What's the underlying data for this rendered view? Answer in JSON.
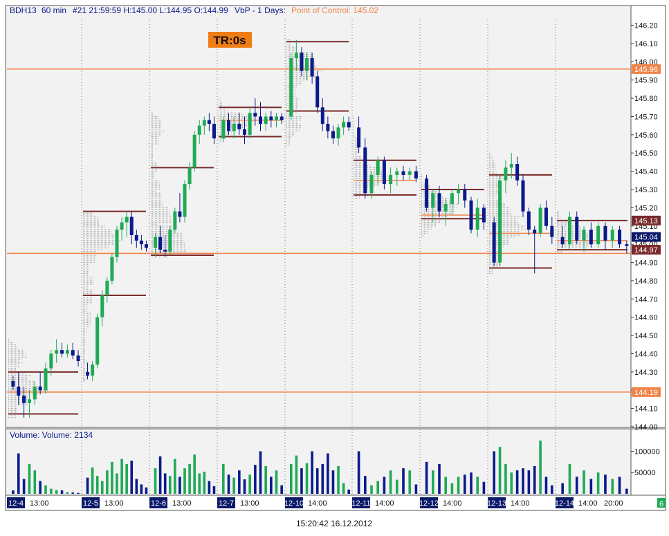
{
  "header": {
    "symbol": "BDH13",
    "interval": "60 min",
    "bar_info": "#21 21:59:59 H:145.00 L:144.95 O:144.99",
    "indicator": "VbP - 1 Days:",
    "poc_label": "Point of Control: 145.02"
  },
  "timer_badge": "TR:0s",
  "volume_panel": {
    "title": "Volume:  Volume: 2134"
  },
  "footer_timestamp": "15:20:42 16.12.2012",
  "status_badge": "6",
  "colors": {
    "up": "#1faa55",
    "down": "#0a1a8c",
    "profile": "#a9a9a9",
    "poc": "#f2844a",
    "value_area": "#7a2a2a",
    "badge": "#f07c14",
    "date_badge": "#0c1a6a"
  },
  "chart_data": [
    {
      "type": "candlestick",
      "title": "BDH13 60 min",
      "ylim": [
        144.0,
        146.24
      ],
      "y_ticks": [
        "146.20",
        "146.10",
        "146.00",
        "145.90",
        "145.80",
        "145.70",
        "145.60",
        "145.50",
        "145.40",
        "145.30",
        "145.20",
        "145.10",
        "145.00",
        "144.90",
        "144.80",
        "144.70",
        "144.60",
        "144.50",
        "144.40",
        "144.30",
        "144.20",
        "144.10",
        "144.00"
      ],
      "sessions": [
        {
          "label": "12-4",
          "time_label": "13:00",
          "poc": 144.19,
          "va_high": 144.3,
          "va_low": 144.07,
          "bars": [
            [
              144.25,
              144.28,
              144.2,
              144.22
            ],
            [
              144.22,
              144.3,
              144.12,
              144.17
            ],
            [
              144.17,
              144.22,
              144.05,
              144.13
            ],
            [
              144.13,
              144.2,
              144.05,
              144.15
            ],
            [
              144.15,
              144.25,
              144.12,
              144.22
            ],
            [
              144.22,
              144.3,
              144.18,
              144.2
            ],
            [
              144.2,
              144.35,
              144.18,
              144.32
            ],
            [
              144.32,
              144.42,
              144.28,
              144.4
            ],
            [
              144.4,
              144.48,
              144.35,
              144.42
            ],
            [
              144.42,
              144.46,
              144.38,
              144.4
            ],
            [
              144.4,
              144.45,
              144.38,
              144.42
            ],
            [
              144.42,
              144.46,
              144.37,
              144.39
            ],
            [
              144.39,
              144.42,
              144.33,
              144.36
            ]
          ]
        },
        {
          "label": "12-5",
          "time_label": "13:00",
          "poc": 144.95,
          "va_high": 145.18,
          "va_low": 144.72,
          "bars": [
            [
              144.3,
              144.35,
              144.26,
              144.28
            ],
            [
              144.28,
              144.36,
              144.25,
              144.34
            ],
            [
              144.34,
              144.62,
              144.32,
              144.6
            ],
            [
              144.6,
              144.75,
              144.55,
              144.72
            ],
            [
              144.72,
              144.82,
              144.68,
              144.8
            ],
            [
              144.8,
              144.95,
              144.78,
              144.93
            ],
            [
              144.93,
              145.1,
              144.9,
              145.08
            ],
            [
              145.08,
              145.15,
              145.02,
              145.12
            ],
            [
              145.12,
              145.18,
              145.04,
              145.15
            ],
            [
              145.15,
              145.18,
              145.0,
              145.05
            ],
            [
              145.05,
              145.08,
              144.98,
              145.02
            ],
            [
              145.02,
              145.05,
              144.97,
              145.0
            ],
            [
              145.0,
              145.02,
              144.96,
              144.98
            ]
          ]
        },
        {
          "label": "12-6",
          "time_label": "13:00",
          "poc": 144.95,
          "va_high": 145.42,
          "va_low": 144.94,
          "bars": [
            [
              144.98,
              145.06,
              144.93,
              145.04
            ],
            [
              145.04,
              145.1,
              144.95,
              144.97
            ],
            [
              144.97,
              145.05,
              144.93,
              144.96
            ],
            [
              144.96,
              145.1,
              144.94,
              145.08
            ],
            [
              145.08,
              145.2,
              145.06,
              145.18
            ],
            [
              145.18,
              145.28,
              145.12,
              145.15
            ],
            [
              145.15,
              145.35,
              145.12,
              145.33
            ],
            [
              145.33,
              145.45,
              145.3,
              145.42
            ],
            [
              145.42,
              145.62,
              145.4,
              145.6
            ],
            [
              145.6,
              145.68,
              145.55,
              145.65
            ],
            [
              145.65,
              145.7,
              145.6,
              145.68
            ],
            [
              145.68,
              145.72,
              145.62,
              145.66
            ],
            [
              145.66,
              145.7,
              145.55,
              145.58
            ]
          ]
        },
        {
          "label": "12-7",
          "time_label": "13:00",
          "poc": 145.68,
          "va_high": 145.75,
          "va_low": 145.59,
          "bars": [
            [
              145.58,
              145.7,
              145.56,
              145.68
            ],
            [
              145.68,
              145.72,
              145.6,
              145.62
            ],
            [
              145.62,
              145.7,
              145.58,
              145.66
            ],
            [
              145.66,
              145.72,
              145.6,
              145.63
            ],
            [
              145.63,
              145.7,
              145.55,
              145.6
            ],
            [
              145.6,
              145.75,
              145.58,
              145.72
            ],
            [
              145.72,
              145.8,
              145.65,
              145.7
            ],
            [
              145.7,
              145.78,
              145.62,
              145.66
            ],
            [
              145.66,
              145.72,
              145.62,
              145.7
            ],
            [
              145.7,
              145.73,
              145.64,
              145.68
            ],
            [
              145.68,
              145.72,
              145.64,
              145.7
            ],
            [
              145.7,
              145.72,
              145.66,
              145.68
            ]
          ]
        },
        {
          "label": "12-10",
          "time_label": "14:00",
          "poc": 145.96,
          "va_high": 146.11,
          "va_low": 145.73,
          "bars": [
            [
              145.7,
              146.05,
              145.68,
              146.02
            ],
            [
              146.02,
              146.12,
              145.95,
              146.05
            ],
            [
              146.05,
              146.08,
              145.92,
              145.95
            ],
            [
              145.95,
              146.05,
              145.9,
              146.02
            ],
            [
              146.02,
              146.05,
              145.88,
              145.92
            ],
            [
              145.92,
              145.95,
              145.72,
              145.75
            ],
            [
              145.75,
              145.8,
              145.62,
              145.66
            ],
            [
              145.66,
              145.7,
              145.58,
              145.62
            ],
            [
              145.62,
              145.65,
              145.55,
              145.58
            ],
            [
              145.58,
              145.66,
              145.54,
              145.64
            ],
            [
              145.64,
              145.7,
              145.6,
              145.67
            ],
            [
              145.67,
              145.7,
              145.62,
              145.64
            ]
          ]
        },
        {
          "label": "12-11",
          "time_label": "14:00",
          "poc": 145.35,
          "va_high": 145.46,
          "va_low": 145.27,
          "bars": [
            [
              145.64,
              145.7,
              145.5,
              145.53
            ],
            [
              145.53,
              145.58,
              145.25,
              145.28
            ],
            [
              145.28,
              145.4,
              145.25,
              145.38
            ],
            [
              145.38,
              145.48,
              145.32,
              145.46
            ],
            [
              145.46,
              145.48,
              145.3,
              145.33
            ],
            [
              145.33,
              145.42,
              145.28,
              145.38
            ],
            [
              145.38,
              145.42,
              145.32,
              145.4
            ],
            [
              145.4,
              145.43,
              145.35,
              145.38
            ],
            [
              145.38,
              145.42,
              145.35,
              145.4
            ],
            [
              145.4,
              145.43,
              145.34,
              145.36
            ]
          ]
        },
        {
          "label": "12-12",
          "time_label": "14:00",
          "poc": 145.16,
          "va_high": 145.3,
          "va_low": 145.14,
          "bars": [
            [
              145.36,
              145.38,
              145.18,
              145.2
            ],
            [
              145.2,
              145.3,
              145.12,
              145.28
            ],
            [
              145.28,
              145.32,
              145.15,
              145.18
            ],
            [
              145.18,
              145.25,
              145.1,
              145.22
            ],
            [
              145.22,
              145.3,
              145.16,
              145.28
            ],
            [
              145.28,
              145.33,
              145.22,
              145.3
            ],
            [
              145.3,
              145.33,
              145.2,
              145.24
            ],
            [
              145.24,
              145.26,
              145.06,
              145.08
            ],
            [
              145.08,
              145.25,
              145.04,
              145.2
            ],
            [
              145.2,
              145.22,
              145.08,
              145.12
            ]
          ]
        },
        {
          "label": "12-13",
          "time_label": "14:00",
          "poc": 145.06,
          "va_high": 145.38,
          "va_low": 144.87,
          "bars": [
            [
              145.12,
              145.15,
              144.88,
              144.9
            ],
            [
              144.9,
              145.38,
              144.88,
              145.35
            ],
            [
              145.35,
              145.46,
              145.28,
              145.42
            ],
            [
              145.42,
              145.5,
              145.36,
              145.44
            ],
            [
              145.44,
              145.48,
              145.32,
              145.35
            ],
            [
              145.35,
              145.38,
              145.15,
              145.18
            ],
            [
              145.18,
              145.2,
              145.05,
              145.08
            ],
            [
              145.08,
              145.1,
              144.84,
              145.06
            ],
            [
              145.06,
              145.22,
              145.04,
              145.2
            ],
            [
              145.2,
              145.24,
              145.08,
              145.1
            ],
            [
              145.1,
              145.15,
              145.0,
              145.04
            ]
          ]
        },
        {
          "label": "12-14",
          "time_label": "14:00",
          "poc": 145.02,
          "va_high": 145.13,
          "va_low": 144.97,
          "bars": [
            [
              145.04,
              145.1,
              144.98,
              145.0
            ],
            [
              145.0,
              145.18,
              144.97,
              145.15
            ],
            [
              145.15,
              145.18,
              145.0,
              145.02
            ],
            [
              145.02,
              145.1,
              144.96,
              145.08
            ],
            [
              145.08,
              145.12,
              144.98,
              145.0
            ],
            [
              145.0,
              145.12,
              144.98,
              145.1
            ],
            [
              145.1,
              145.12,
              144.97,
              145.02
            ],
            [
              145.02,
              145.1,
              144.98,
              145.08
            ],
            [
              145.08,
              145.1,
              144.98,
              145.0
            ],
            [
              145.0,
              145.02,
              144.95,
              144.99
            ]
          ]
        }
      ],
      "extra_time_label": "20:00",
      "price_labels": [
        {
          "value": "145.96",
          "kind": "poc"
        },
        {
          "value": "145.13",
          "kind": "va"
        },
        {
          "value": "145.04",
          "kind": "last"
        },
        {
          "value": "144.97",
          "kind": "va"
        },
        {
          "value": "144.19",
          "kind": "poc"
        }
      ],
      "horizontal_lines": [
        145.96,
        144.95,
        144.19
      ]
    },
    {
      "type": "bar",
      "title": "Volume",
      "ylim": [
        0,
        130000
      ],
      "y_ticks": [
        "100000",
        "50000"
      ],
      "values": [
        [
          8000,
          95000,
          35000,
          70000,
          55000,
          30000,
          20000,
          12000,
          9000,
          8000,
          4000,
          3000,
          2000
        ],
        [
          38000,
          62000,
          42000,
          30000,
          55000,
          75000,
          48000,
          82000,
          70000,
          78000,
          35000,
          22000,
          15000
        ],
        [
          60000,
          88000,
          48000,
          42000,
          82000,
          40000,
          60000,
          70000,
          92000,
          48000,
          52000,
          30000,
          18000
        ],
        [
          70000,
          45000,
          38000,
          55000,
          34000,
          45000,
          68000,
          100000,
          65000,
          40000,
          55000,
          20000
        ],
        [
          70000,
          90000,
          60000,
          72000,
          100000,
          60000,
          70000,
          95000,
          55000,
          65000,
          25000,
          10000
        ],
        [
          100000,
          42000,
          20000,
          30000,
          40000,
          55000,
          33000,
          60000,
          55000,
          22000
        ],
        [
          75000,
          55000,
          70000,
          40000,
          25000,
          40000,
          45000,
          50000,
          40000,
          28000
        ],
        [
          100000,
          110000,
          70000,
          50000,
          55000,
          60000,
          55000,
          65000,
          125000,
          40000,
          20000
        ],
        [
          25000,
          70000,
          40000,
          55000,
          35000,
          50000,
          45000,
          35000,
          40000,
          12000
        ]
      ]
    }
  ]
}
